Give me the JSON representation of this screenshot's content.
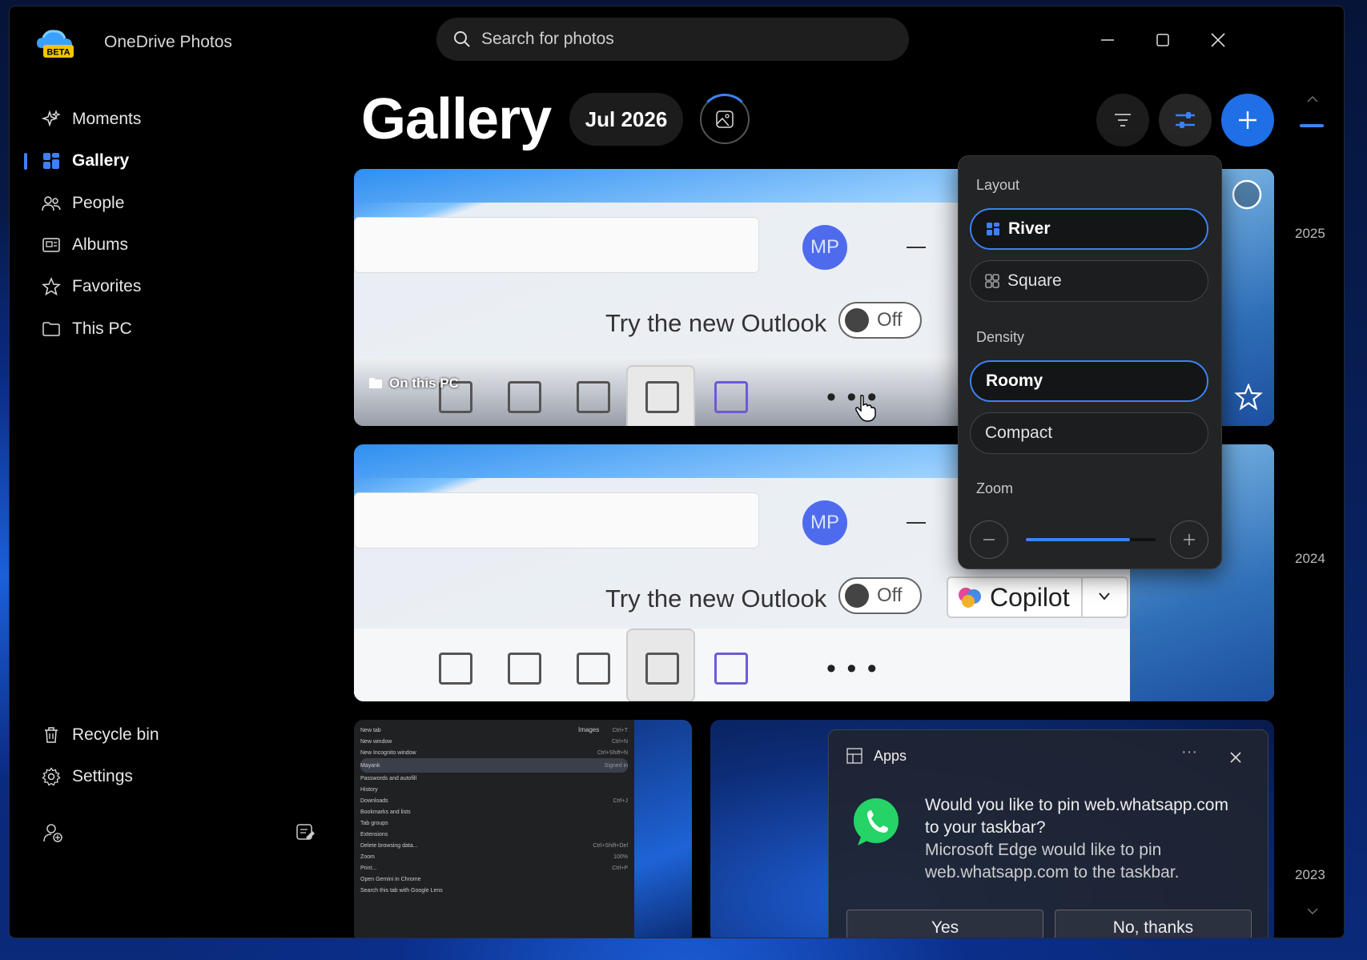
{
  "app": {
    "name": "OneDrive Photos",
    "badge": "BETA"
  },
  "search": {
    "placeholder": "Search for photos"
  },
  "window_controls": {
    "minimize_icon": "minimize-icon",
    "maximize_icon": "maximize-icon",
    "close_icon": "close-icon"
  },
  "sidebar": {
    "items": [
      {
        "label": "Moments",
        "icon": "sparkle-icon"
      },
      {
        "label": "Gallery",
        "icon": "gallery-icon",
        "active": true
      },
      {
        "label": "People",
        "icon": "people-icon"
      },
      {
        "label": "Albums",
        "icon": "album-icon"
      },
      {
        "label": "Favorites",
        "icon": "star-icon"
      },
      {
        "label": "This PC",
        "icon": "folder-icon"
      }
    ],
    "bottom": [
      {
        "label": "Recycle bin",
        "icon": "trash-icon"
      },
      {
        "label": "Settings",
        "icon": "gear-icon"
      }
    ]
  },
  "header": {
    "title": "Gallery",
    "date": "Jul 2026"
  },
  "colors": {
    "accent": "#3b82f6",
    "bg": "#000000",
    "popup_bg": "#222426"
  },
  "view_menu": {
    "layout_label": "Layout",
    "layout_options": [
      "River",
      "Square"
    ],
    "layout_selected": "River",
    "density_label": "Density",
    "density_options": [
      "Roomy",
      "Compact"
    ],
    "density_selected": "Roomy",
    "zoom_label": "Zoom",
    "zoom_level": 0.8
  },
  "photos": {
    "photo1": {
      "mp": "MP",
      "try": "Try the new Outlook",
      "toggle": "Off",
      "location": "On this PC"
    },
    "photo2": {
      "mp": "MP",
      "try": "Try the new Outlook",
      "toggle": "Off",
      "copilot": "Copilot"
    },
    "chrome_menu": {
      "items": [
        "New tab",
        "New window",
        "New Incognito window",
        "Mayank",
        "Passwords and autofill",
        "History",
        "Downloads",
        "Bookmarks and lists",
        "Tab groups",
        "Extensions",
        "Delete browsing data...",
        "Zoom",
        "Print...",
        "Open Gemini in Chrome",
        "Search this tab with Google Lens"
      ],
      "shortcuts": [
        "Ctrl+T",
        "Ctrl+N",
        "Ctrl+Shift+N",
        "Signed in",
        "",
        "",
        "Ctrl+J",
        "",
        "",
        "",
        "Ctrl+Shift+Del",
        "100%",
        "Ctrl+P",
        "",
        ""
      ],
      "images_label": "Images"
    },
    "whatsapp": {
      "header": "Apps",
      "question": "Would you like to pin web.whatsapp.com to your taskbar?",
      "detail": "Microsoft Edge would like to pin web.whatsapp.com to the taskbar.",
      "yes": "Yes",
      "no": "No, thanks"
    }
  },
  "timeline": {
    "years": [
      "2025",
      "2024",
      "2023"
    ]
  }
}
